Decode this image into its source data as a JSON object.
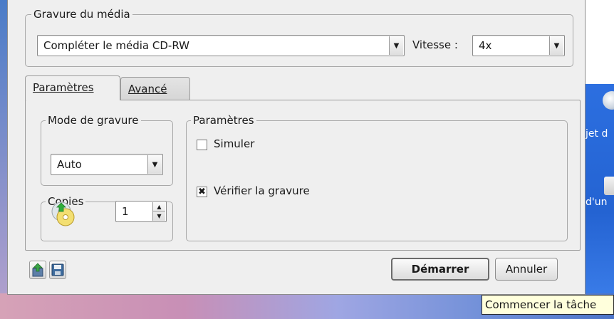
{
  "dialog": {
    "burn_group_title": "Gravure du média",
    "burn_action": "Compléter le média CD-RW",
    "speed_label": "Vitesse :",
    "speed_value": "4x",
    "tabs": [
      {
        "label": "Paramètres",
        "active": true
      },
      {
        "label": "Avancé",
        "active": false
      }
    ],
    "mode_group_title": "Mode de gravure",
    "mode_value": "Auto",
    "copies_group_title": "Copies",
    "copies_value": "1",
    "params_group_title": "Paramètres",
    "options": [
      {
        "label": "Simuler",
        "checked": false
      },
      {
        "label": "Vérifier la gravure",
        "checked": true
      }
    ],
    "start_button": "Démarrer",
    "cancel_button": "Annuler"
  },
  "tooltip": "Commencer la tâche",
  "desktop": {
    "label_1": "jet d",
    "label_2": "d'un"
  },
  "colors": {
    "dialog_bg": "#efefef",
    "tooltip_bg": "#ffffdc"
  }
}
